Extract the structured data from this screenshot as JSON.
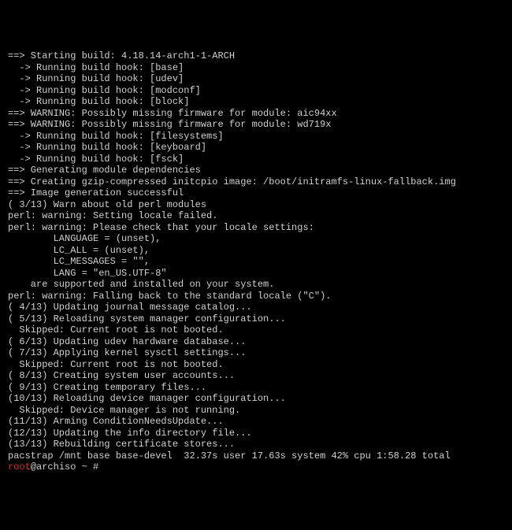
{
  "lines": [
    "==> Starting build: 4.18.14-arch1-1-ARCH",
    "  -> Running build hook: [base]",
    "  -> Running build hook: [udev]",
    "  -> Running build hook: [modconf]",
    "  -> Running build hook: [block]",
    "==> WARNING: Possibly missing firmware for module: aic94xx",
    "==> WARNING: Possibly missing firmware for module: wd719x",
    "  -> Running build hook: [filesystems]",
    "  -> Running build hook: [keyboard]",
    "  -> Running build hook: [fsck]",
    "==> Generating module dependencies",
    "==> Creating gzip-compressed initcpio image: /boot/initramfs-linux-fallback.img",
    "==> Image generation successful",
    "( 3/13) Warn about old perl modules",
    "perl: warning: Setting locale failed.",
    "perl: warning: Please check that your locale settings:",
    "        LANGUAGE = (unset),",
    "        LC_ALL = (unset),",
    "        LC_MESSAGES = \"\",",
    "        LANG = \"en_US.UTF-8\"",
    "    are supported and installed on your system.",
    "perl: warning: Falling back to the standard locale (\"C\").",
    "( 4/13) Updating journal message catalog...",
    "( 5/13) Reloading system manager configuration...",
    "  Skipped: Current root is not booted.",
    "( 6/13) Updating udev hardware database...",
    "( 7/13) Applying kernel sysctl settings...",
    "  Skipped: Current root is not booted.",
    "( 8/13) Creating system user accounts...",
    "( 9/13) Creating temporary files...",
    "(10/13) Reloading device manager configuration...",
    "  Skipped: Device manager is not running.",
    "(11/13) Arming ConditionNeedsUpdate...",
    "(12/13) Updating the info directory file...",
    "(13/13) Rebuilding certificate stores...",
    "pacstrap /mnt base base-devel  32.37s user 17.63s system 42% cpu 1:58.28 total"
  ],
  "prompt": {
    "user": "root",
    "at": "@archiso",
    "path": " ~ # "
  }
}
